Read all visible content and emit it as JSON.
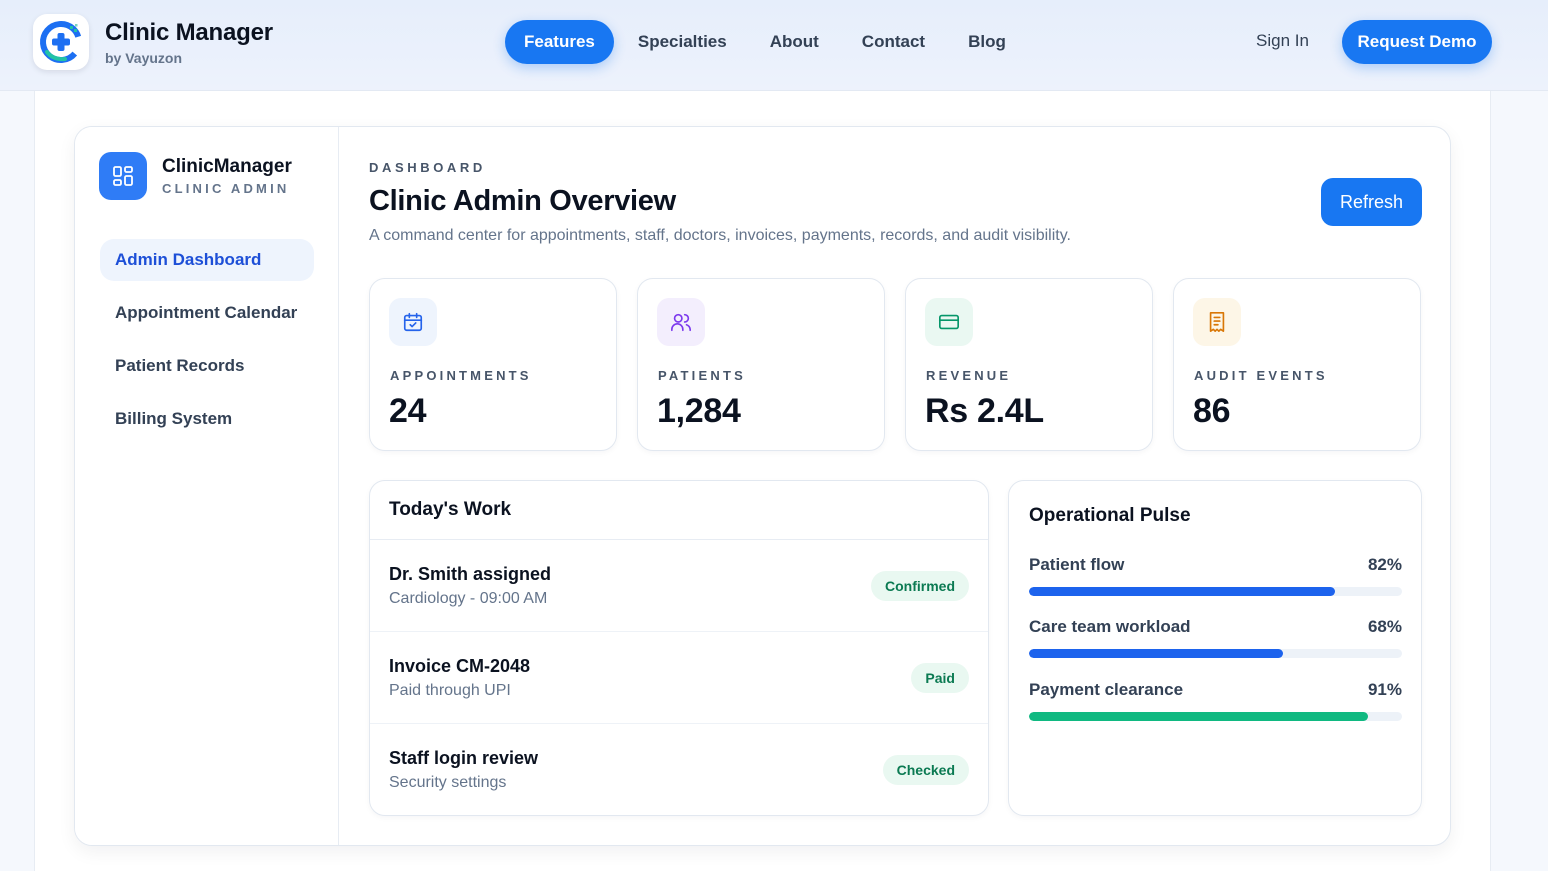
{
  "topnav": {
    "brand_title": "Clinic Manager",
    "brand_sub": "by Vayuzon",
    "links": [
      {
        "label": "Features",
        "active": true
      },
      {
        "label": "Specialties",
        "active": false
      },
      {
        "label": "About",
        "active": false
      },
      {
        "label": "Contact",
        "active": false
      },
      {
        "label": "Blog",
        "active": false
      }
    ],
    "signin_label": "Sign In",
    "demo_label": "Request Demo"
  },
  "sidebar": {
    "title": "ClinicManager",
    "subtitle": "CLINIC ADMIN",
    "items": [
      {
        "label": "Admin Dashboard",
        "active": true
      },
      {
        "label": "Appointment Calendar",
        "active": false
      },
      {
        "label": "Patient Records",
        "active": false
      },
      {
        "label": "Billing System",
        "active": false
      }
    ]
  },
  "header": {
    "eyebrow": "DASHBOARD",
    "title": "Clinic Admin Overview",
    "description": "A command center for appointments, staff, doctors, invoices, payments, records, and audit visibility.",
    "refresh_label": "Refresh"
  },
  "stats": [
    {
      "label": "APPOINTMENTS",
      "value": "24",
      "icon": "calendar-check-icon",
      "icon_color": "#2563eb",
      "icon_bg": "#eef4fd"
    },
    {
      "label": "PATIENTS",
      "value": "1,284",
      "icon": "users-icon",
      "icon_color": "#7c3aed",
      "icon_bg": "#f3eefd"
    },
    {
      "label": "REVENUE",
      "value": "Rs 2.4L",
      "icon": "credit-card-icon",
      "icon_color": "#059669",
      "icon_bg": "#eaf8f2"
    },
    {
      "label": "AUDIT EVENTS",
      "value": "86",
      "icon": "receipt-icon",
      "icon_color": "#d97706",
      "icon_bg": "#fdf6e7"
    }
  ],
  "work": {
    "title": "Today's Work",
    "rows": [
      {
        "name": "Dr. Smith assigned",
        "meta": "Cardiology - 09:00 AM",
        "status": "Confirmed"
      },
      {
        "name": "Invoice CM-2048",
        "meta": "Paid through UPI",
        "status": "Paid"
      },
      {
        "name": "Staff login review",
        "meta": "Security settings",
        "status": "Checked"
      }
    ]
  },
  "pulse": {
    "title": "Operational Pulse",
    "items": [
      {
        "label": "Patient flow",
        "pct_text": "82%",
        "value": 82,
        "color": "#1d63ed"
      },
      {
        "label": "Care team workload",
        "pct_text": "68%",
        "value": 68,
        "color": "#1d63ed"
      },
      {
        "label": "Payment clearance",
        "pct_text": "91%",
        "value": 91,
        "color": "#10b981"
      }
    ]
  },
  "colors": {
    "accent": "#1877f2",
    "success_badge_bg": "#e9f8f1",
    "success_badge_text": "#0b7a52"
  }
}
